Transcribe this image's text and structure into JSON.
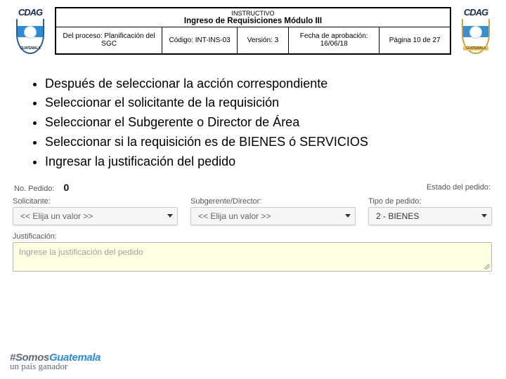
{
  "logos": {
    "brand": "CDAG",
    "country": "GUATEMALA"
  },
  "header": {
    "supertitle": "INSTRUCTIVO",
    "title": "Ingreso de Requisiciones Módulo III",
    "process_label": "Del proceso: Planificación del SGC",
    "code_label": "Código: INT-INS-03",
    "version_label": "Versión: 3",
    "approval_label": "Fecha de aprobación: 16/06/18",
    "page_label": "Página 10 de 27"
  },
  "bullets": [
    "Después de seleccionar la acción correspondiente",
    "Seleccionar el solicitante de la requisición",
    "Seleccionar el Subgerente o Director de Área",
    "Seleccionar si la requisición es de BIENES ó SERVICIOS",
    "Ingresar la justificación del pedido"
  ],
  "form": {
    "no_pedido_label": "No. Pedido:",
    "no_pedido_value": "0",
    "estado_label": "Estado del pedido:",
    "solicitante_label": "Solicitante:",
    "solicitante_value": "<< Elija un valor >>",
    "subgerente_label": "Subgerente/Director:",
    "subgerente_value": "<< Elija un valor >>",
    "tipo_label": "Tipo de pedido:",
    "tipo_value": "2 - BIENES",
    "justificacion_label": "Justificación:",
    "justificacion_placeholder": "Ingrese la justificación del pedido"
  },
  "footer": {
    "hashtag_prefix": "#Somos",
    "hashtag_highlight": "Guatemala",
    "slogan": "un país ganador"
  }
}
